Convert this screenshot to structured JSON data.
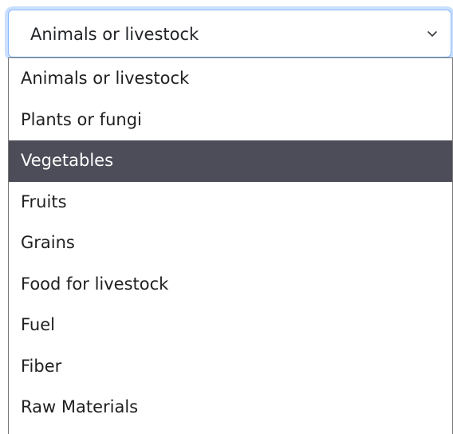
{
  "select": {
    "value": "Animals or livestock",
    "highlight_color": "#4d4d59",
    "focus_color": "#86b7fe",
    "icon": "chevron-down-icon"
  },
  "options": [
    {
      "label": "Animals or livestock",
      "highlighted": false
    },
    {
      "label": "Plants or fungi",
      "highlighted": false
    },
    {
      "label": "Vegetables",
      "highlighted": true
    },
    {
      "label": "Fruits",
      "highlighted": false
    },
    {
      "label": "Grains",
      "highlighted": false
    },
    {
      "label": "Food for livestock",
      "highlighted": false
    },
    {
      "label": "Fuel",
      "highlighted": false
    },
    {
      "label": "Fiber",
      "highlighted": false
    },
    {
      "label": "Raw Materials",
      "highlighted": false
    }
  ]
}
